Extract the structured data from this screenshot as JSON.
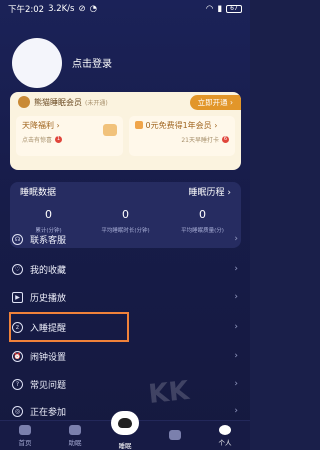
{
  "status_bar": {
    "time": "下午2:02",
    "speed": "3.2K/s",
    "icons_left": [
      "mute-icon",
      "alarm-icon"
    ],
    "icons_right": [
      "wifi-icon",
      "signal-icon"
    ],
    "battery": "67"
  },
  "profile": {
    "login_label": "点击登录"
  },
  "vip": {
    "title": "熊猫睡眠会员",
    "subtitle": "(未开通)",
    "open_button": "立即开通",
    "open_arrow": "›",
    "boxes": [
      {
        "title": "天降福利 ›",
        "sub": "点击有惊喜",
        "badge": "1"
      },
      {
        "title": "0元免费得1年会员 ›",
        "sub": "21天早睡打卡",
        "badge": "6"
      }
    ]
  },
  "stats": {
    "title": "睡眠数据",
    "history": "睡眠历程 ›",
    "items": [
      {
        "value": "0",
        "label": "累计(分钟)"
      },
      {
        "value": "0",
        "label": "平均睡眠时长(分钟)"
      },
      {
        "value": "0",
        "label": "平均睡眠质量(分)"
      }
    ]
  },
  "menu": {
    "items": [
      {
        "label": "联系客服",
        "icon": "headset-icon"
      },
      {
        "label": "我的收藏",
        "icon": "favorites-icon"
      },
      {
        "label": "历史播放",
        "icon": "history-icon"
      },
      {
        "label": "入睡提醒",
        "icon": "sleep-reminder-icon"
      },
      {
        "label": "闹钟设置",
        "icon": "alarm-clock-icon"
      },
      {
        "label": "常见问题",
        "icon": "help-icon"
      },
      {
        "label": "正在参加",
        "icon": "participating-icon"
      }
    ],
    "arrow": "›"
  },
  "bottom_nav": {
    "items": [
      {
        "label": "首页",
        "icon": "home-icon"
      },
      {
        "label": "助眠",
        "icon": "sleep-aid-icon"
      },
      {
        "label": "睡眠",
        "icon": "panda-icon"
      },
      {
        "label": "",
        "icon": "community-icon"
      },
      {
        "label": "个人",
        "icon": "profile-icon"
      }
    ]
  },
  "colors": {
    "background": "#1b2258",
    "vip_accent": "#e2962a",
    "highlight": "#f0823a"
  }
}
